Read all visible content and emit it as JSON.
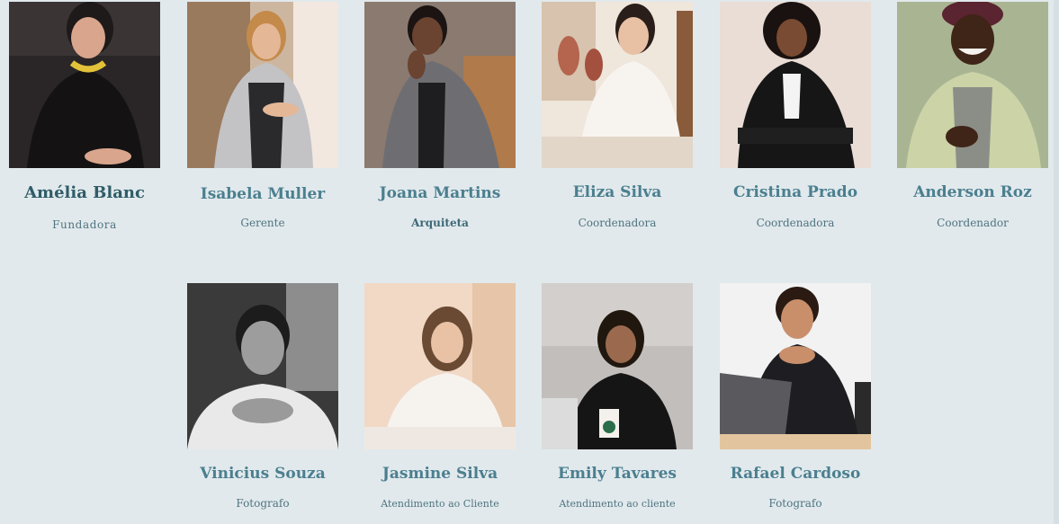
{
  "team": {
    "members": [
      {
        "name": "Amélia Blanc",
        "role": "Fundadora"
      },
      {
        "name": "Isabela Muller",
        "role": "Gerente"
      },
      {
        "name": "Joana Martins",
        "role": "Arquiteta"
      },
      {
        "name": "Eliza Silva",
        "role": "Coordenadora"
      },
      {
        "name": "Cristina Prado",
        "role": "Coordenadora"
      },
      {
        "name": "Anderson  Roz",
        "role": "Coordenador"
      },
      {
        "name": "Vinicius Souza",
        "role": "Fotografo"
      },
      {
        "name": "Jasmine Silva",
        "role": "Atendimento ao Cliente"
      },
      {
        "name": "Emily Tavares",
        "role": "Atendimento ao cliente"
      },
      {
        "name": "Rafael Cardoso",
        "role": "Fotografo"
      }
    ]
  },
  "colors": {
    "background": "#e1e9ec",
    "name_text": "#4b7f8f",
    "role_text": "#4f7480"
  }
}
